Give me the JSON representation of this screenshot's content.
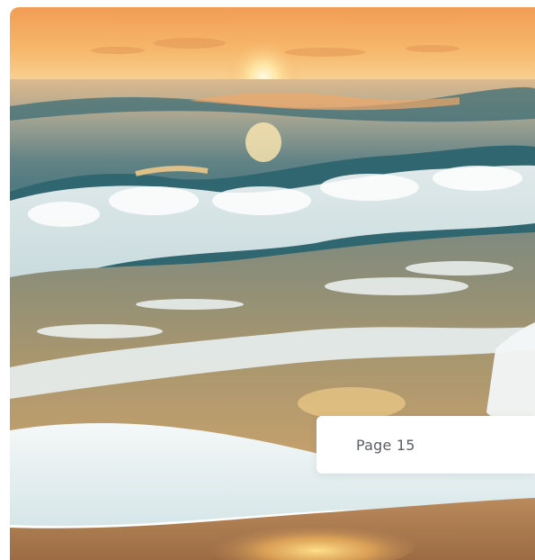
{
  "photo": {
    "subject": "sunset-beach-waves",
    "colors": {
      "sky_top": "#f3a45a",
      "sky_horizon": "#f7c27a",
      "sun": "#fff3c4",
      "sea_deep": "#2f5f6a",
      "wave_foam": "#e9f1f2",
      "sand": "#c98d57",
      "sand_reflection": "#ffd27a"
    }
  },
  "page_indicator": {
    "label": "Page 15"
  }
}
